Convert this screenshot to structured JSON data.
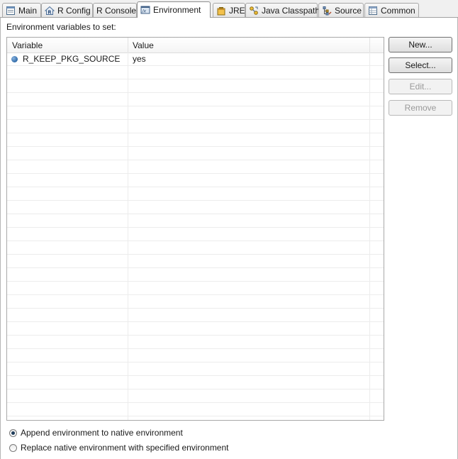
{
  "tabs": [
    {
      "label": "Main",
      "icon": "main-tab-icon",
      "active": false
    },
    {
      "label": "R Config",
      "icon": "r-config-icon",
      "active": false
    },
    {
      "label": "R Console",
      "icon": "",
      "active": false
    },
    {
      "label": "Environment",
      "icon": "environment-icon",
      "active": true
    },
    {
      "label": "JRE",
      "icon": "jre-icon",
      "active": false
    },
    {
      "label": "Java Classpath",
      "icon": "classpath-icon",
      "active": false
    },
    {
      "label": "Source",
      "icon": "source-icon",
      "active": false
    },
    {
      "label": "Common",
      "icon": "common-icon",
      "active": false
    }
  ],
  "environment": {
    "section_label": "Environment variables to set:",
    "columns": [
      "Variable",
      "Value"
    ],
    "rows": [
      {
        "variable": "R_KEEP_PKG_SOURCE",
        "value": "yes"
      }
    ]
  },
  "buttons": {
    "new": "New...",
    "select": "Select...",
    "edit": "Edit...",
    "remove": "Remove"
  },
  "options": {
    "append": "Append environment to native environment",
    "replace": "Replace native environment with specified environment",
    "selected": "append"
  }
}
